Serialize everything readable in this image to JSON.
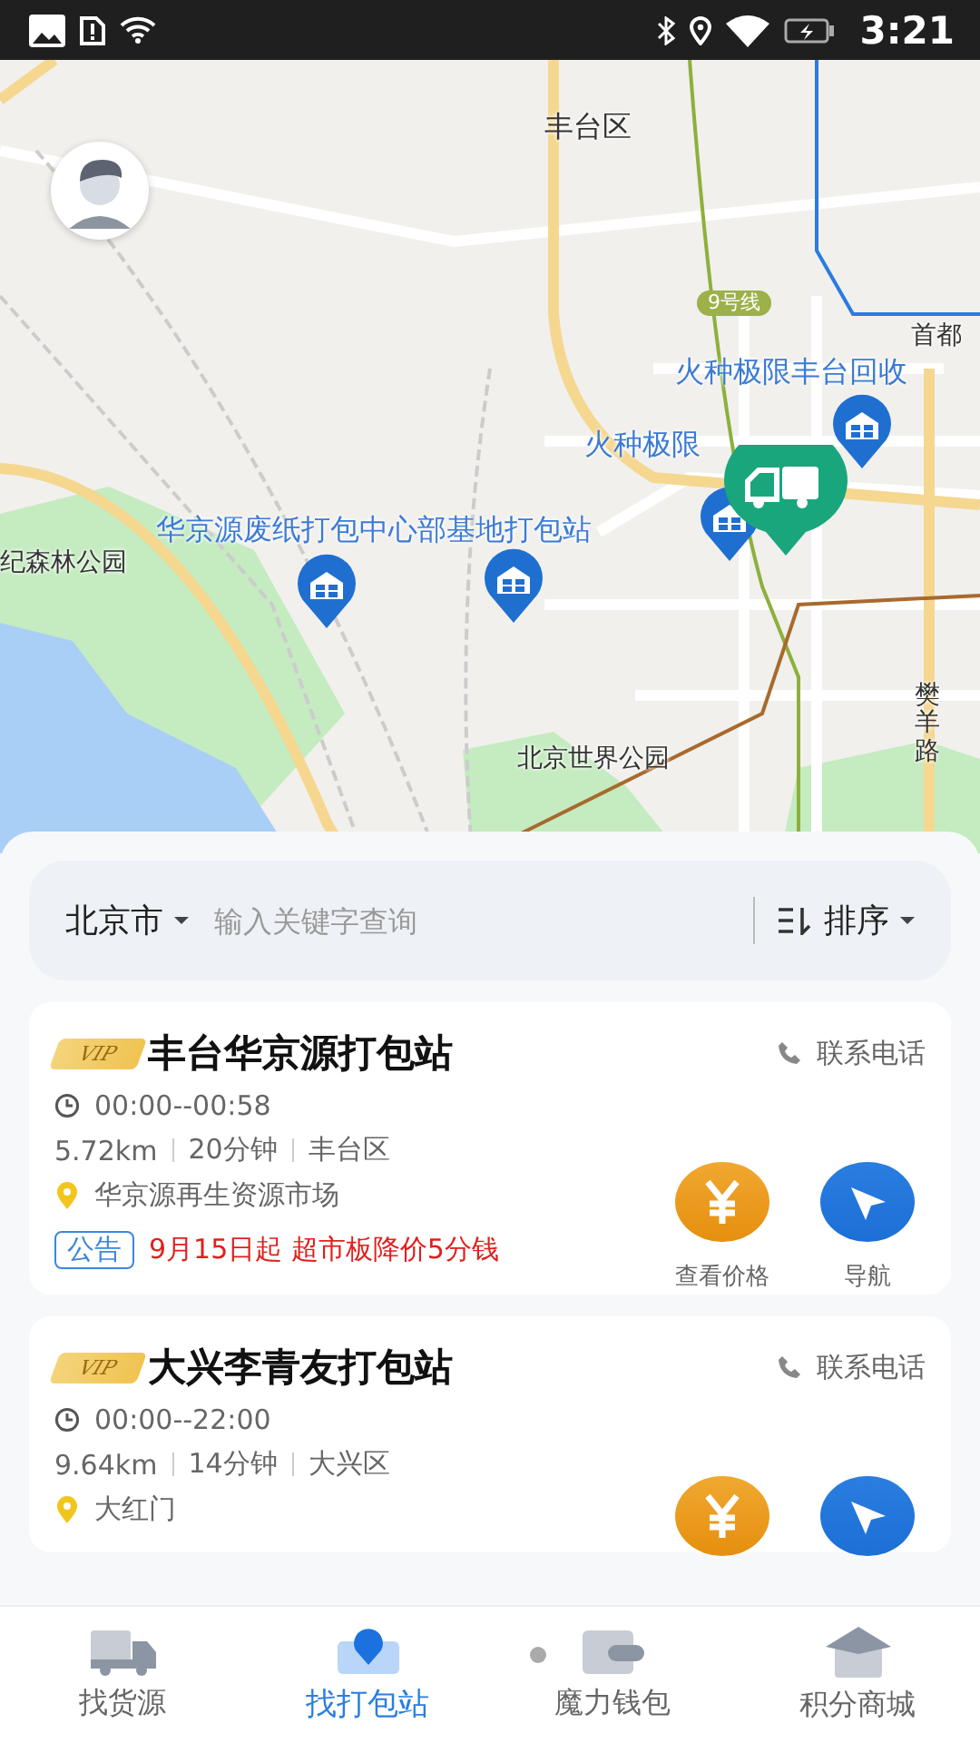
{
  "status_bar": {
    "time": "3:21"
  },
  "map": {
    "labels": [
      {
        "text": "丰台区",
        "kind": "district"
      },
      {
        "text": "9号线",
        "kind": "metro"
      },
      {
        "text": "首都",
        "kind": "place"
      },
      {
        "text": "火种极限丰台回收",
        "kind": "poi"
      },
      {
        "text": "火种极限",
        "kind": "poi"
      },
      {
        "text": "华京源废纸打包中心",
        "kind": "poi"
      },
      {
        "text": "部基地打包站",
        "kind": "poi"
      },
      {
        "text": "纪森林公园",
        "kind": "place"
      },
      {
        "text": "北京世界公园",
        "kind": "place"
      },
      {
        "text": "樊羊路",
        "kind": "road"
      }
    ]
  },
  "search": {
    "city": "北京市",
    "placeholder": "输入关键字查询",
    "sort": "排序"
  },
  "stations": [
    {
      "name": "丰台华京源打包站",
      "vip": "VIP",
      "contact": "联系电话",
      "hours": "00:00--00:58",
      "distance": "5.72km",
      "duration": "20分钟",
      "district": "丰台区",
      "address": "华京源再生资源市场",
      "notice": {
        "tag": "公告",
        "text": "9月15日起 超市板降价5分钱"
      },
      "price_label": "查看价格",
      "nav_label": "导航"
    },
    {
      "name": "大兴李青友打包站",
      "vip": "VIP",
      "contact": "联系电话",
      "hours": "00:00--22:00",
      "distance": "9.64km",
      "duration": "14分钟",
      "district": "大兴区",
      "address": "大红门"
    }
  ],
  "tabs": [
    {
      "label": "找货源",
      "kind": "truck",
      "selected": false,
      "badge": false
    },
    {
      "label": "找打包站",
      "kind": "station",
      "selected": true,
      "badge": false
    },
    {
      "label": "魔力钱包",
      "kind": "wallet",
      "selected": false,
      "badge": true
    },
    {
      "label": "积分商城",
      "kind": "shop",
      "selected": false,
      "badge": false
    }
  ]
}
